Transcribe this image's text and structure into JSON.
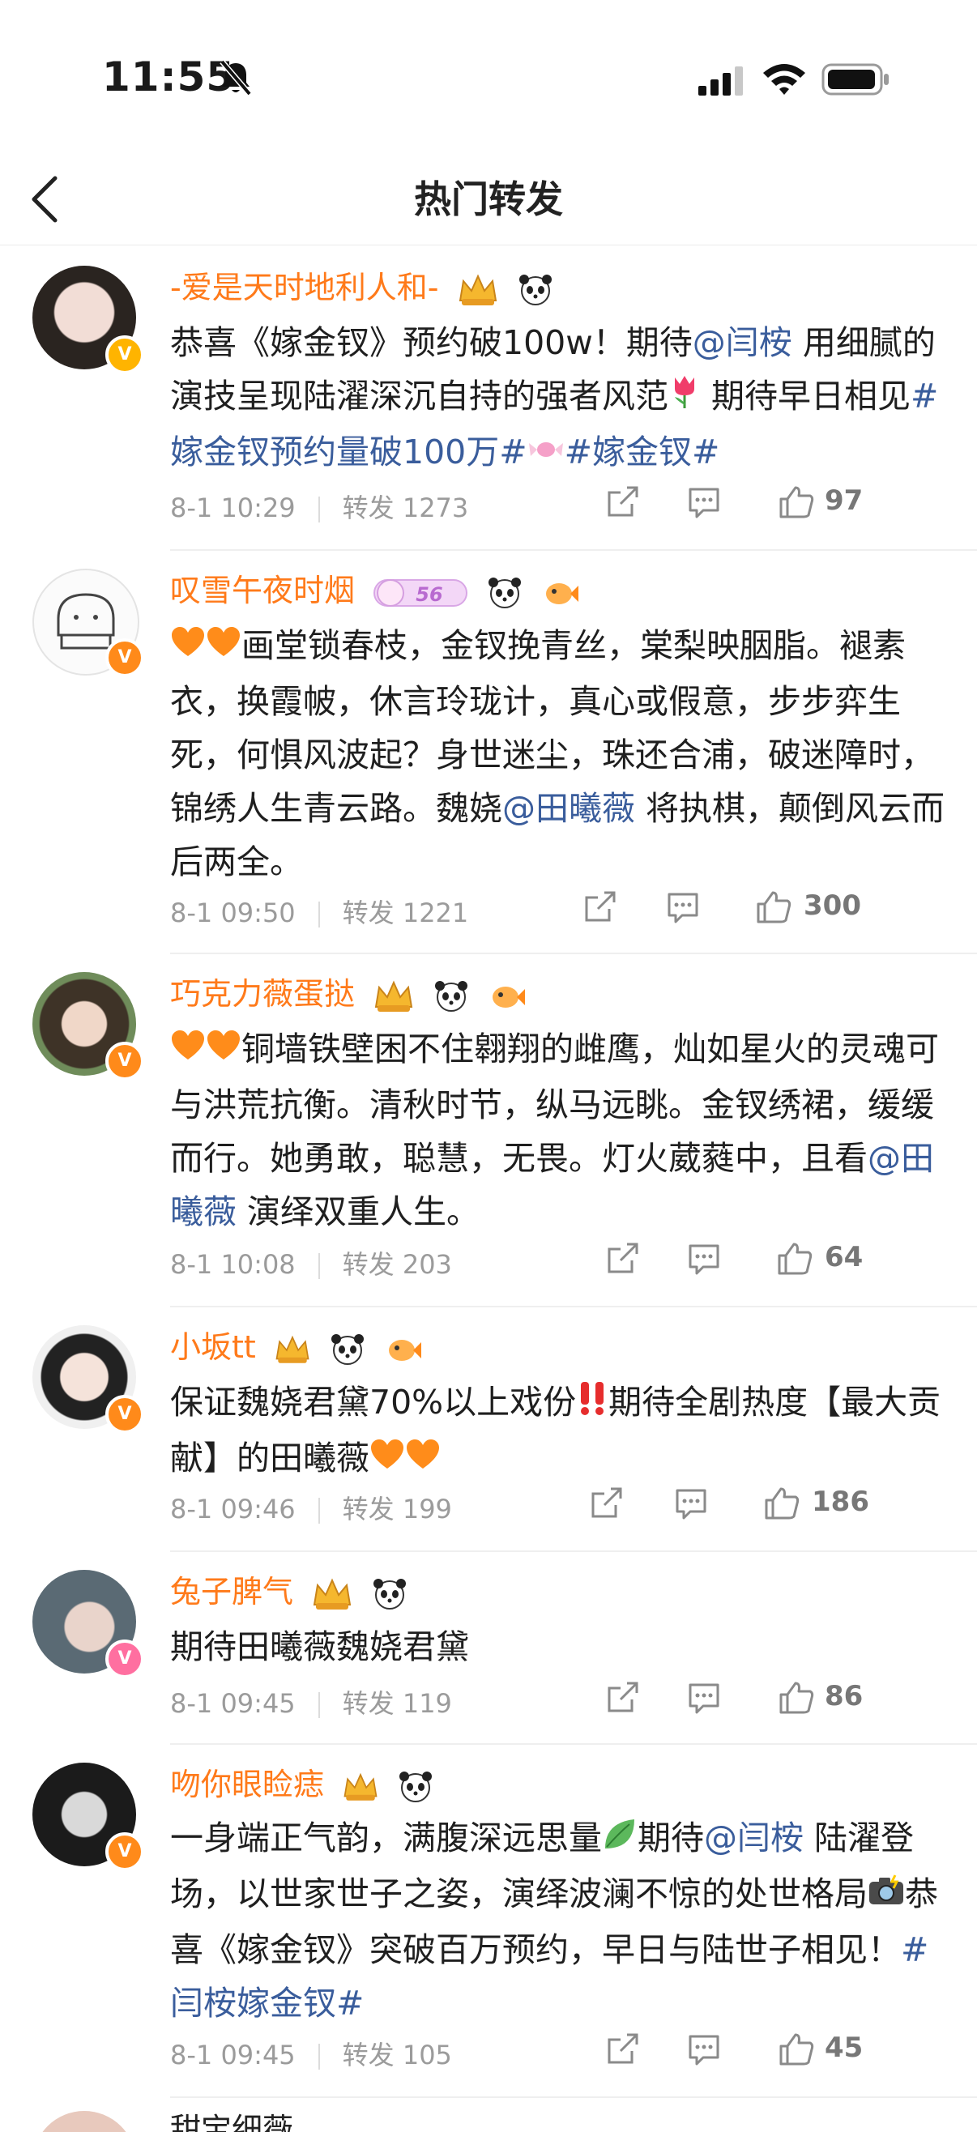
{
  "status_bar": {
    "time": "11:55"
  },
  "nav": {
    "title": "热门转发"
  },
  "posts": [
    {
      "username": "-爱是天时地利人和-",
      "content": [
        {
          "t": "text",
          "v": "恭喜《嫁金钗》预约破100w！期待"
        },
        {
          "t": "link",
          "v": "@闫桉"
        },
        {
          "t": "text",
          "v": " 用细腻的演技呈现陆濯深沉自持的强者风范"
        },
        {
          "t": "icon",
          "v": "tulip-emoji"
        },
        {
          "t": "text",
          "v": " 期待早日相见"
        },
        {
          "t": "link",
          "v": "#嫁金钗预约量破100万#"
        },
        {
          "t": "icon",
          "v": "candy-emoji"
        },
        {
          "t": "link",
          "v": "#嫁金钗#"
        }
      ],
      "date": "8-1 10:29",
      "repost": "转发 1273",
      "likes": "97"
    },
    {
      "username": "叹雪午夜时烟",
      "badge_level": "56",
      "content": [
        {
          "t": "icon",
          "v": "orange-heart-emoji"
        },
        {
          "t": "icon",
          "v": "orange-heart-emoji"
        },
        {
          "t": "text",
          "v": "画堂锁春枝，金钗挽青丝，棠梨映胭脂。褪素衣，换霞帔，休言玲珑计，真心或假意，步步弈生死，何惧风波起？身世迷尘，珠还合浦，破迷障时，锦绣人生青云路。魏娆"
        },
        {
          "t": "link",
          "v": "@田曦薇"
        },
        {
          "t": "text",
          "v": " 将执棋，颠倒风云而后两全。"
        }
      ],
      "date": "8-1 09:50",
      "repost": "转发 1221",
      "likes": "300"
    },
    {
      "username": "巧克力薇蛋挞",
      "content": [
        {
          "t": "icon",
          "v": "orange-heart-emoji"
        },
        {
          "t": "icon",
          "v": "orange-heart-emoji"
        },
        {
          "t": "text",
          "v": "铜墙铁壁困不住翱翔的雌鹰，灿如星火的灵魂可与洪荒抗衡。清秋时节，纵马远眺。金钗绣裙，缓缓而行。她勇敢，聪慧，无畏。灯火葳蕤中，且看"
        },
        {
          "t": "link",
          "v": "@田曦薇"
        },
        {
          "t": "text",
          "v": " 演绎双重人生。"
        }
      ],
      "date": "8-1 10:08",
      "repost": "转发 203",
      "likes": "64"
    },
    {
      "username": "小坂tt",
      "content": [
        {
          "t": "text",
          "v": "保证魏娆君黛70%以上戏份"
        },
        {
          "t": "icon",
          "v": "double-exclamation-emoji"
        },
        {
          "t": "text",
          "v": "期待全剧热度【最大贡献】的田曦薇"
        },
        {
          "t": "icon",
          "v": "orange-heart-emoji"
        },
        {
          "t": "icon",
          "v": "orange-heart-emoji"
        }
      ],
      "date": "8-1 09:46",
      "repost": "转发 199",
      "likes": "186"
    },
    {
      "username": "兔子脾气",
      "content": [
        {
          "t": "text",
          "v": "期待田曦薇魏娆君黛"
        }
      ],
      "date": "8-1 09:45",
      "repost": "转发 119",
      "likes": "86"
    },
    {
      "username": "吻你眼睑痣",
      "content": [
        {
          "t": "text",
          "v": "一身端正气韵，满腹深远思量"
        },
        {
          "t": "icon",
          "v": "leaf-emoji"
        },
        {
          "t": "text",
          "v": "期待"
        },
        {
          "t": "link",
          "v": "@闫桉"
        },
        {
          "t": "text",
          "v": " 陆濯登场，以世家世子之姿，演绎波澜不惊的处世格局"
        },
        {
          "t": "icon",
          "v": "camera-flash-emoji"
        },
        {
          "t": "text",
          "v": "恭喜《嫁金钗》突破百万预约，早日与陆世子相见！"
        },
        {
          "t": "link",
          "v": "#闫桉嫁金钗#"
        }
      ],
      "date": "8-1 09:45",
      "repost": "转发 105",
      "likes": "45"
    },
    {
      "username": "甜宝细薇",
      "content": [],
      "date": "",
      "repost": "",
      "likes": ""
    }
  ],
  "colors": {
    "username": "#ff7a1a",
    "link": "#3a5d9c",
    "meta": "#9b9b9b",
    "badge": "#ff8a1a"
  }
}
